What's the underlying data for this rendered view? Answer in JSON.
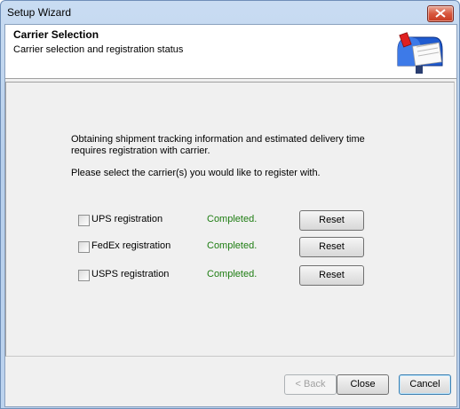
{
  "window": {
    "title": "Setup Wizard"
  },
  "header": {
    "title": "Carrier Selection",
    "subtitle": "Carrier selection and registration status"
  },
  "body": {
    "intro_line1": "Obtaining shipment tracking information and estimated delivery time",
    "intro_line2": "requires registration with carrier.",
    "instruction": "Please select the carrier(s) you would like to register with."
  },
  "carriers": [
    {
      "label": "UPS registration",
      "checked": false,
      "status": "Completed.",
      "button": "Reset"
    },
    {
      "label": "FedEx registration",
      "checked": false,
      "status": "Completed.",
      "button": "Reset"
    },
    {
      "label": "USPS registration",
      "checked": false,
      "status": "Completed.",
      "button": "Reset"
    }
  ],
  "footer": {
    "back_label": "< Back",
    "close_label": "Close",
    "cancel_label": "Cancel"
  },
  "colors": {
    "status_completed": "#1e7d12",
    "title_bar": "#bcd3ee"
  },
  "icons": {
    "header_icon": "mailbox-icon",
    "close": "close-icon"
  }
}
